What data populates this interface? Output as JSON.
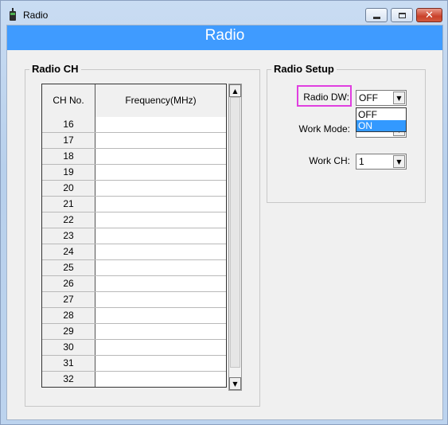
{
  "window": {
    "title": "Radio"
  },
  "banner": {
    "title": "Radio"
  },
  "radio_ch": {
    "group_title": "Radio CH",
    "headers": {
      "ch_no": "CH No.",
      "frequency": "Frequency(MHz)"
    },
    "rows": [
      {
        "ch": "16",
        "freq": ""
      },
      {
        "ch": "17",
        "freq": ""
      },
      {
        "ch": "18",
        "freq": ""
      },
      {
        "ch": "19",
        "freq": ""
      },
      {
        "ch": "20",
        "freq": ""
      },
      {
        "ch": "21",
        "freq": ""
      },
      {
        "ch": "22",
        "freq": ""
      },
      {
        "ch": "23",
        "freq": ""
      },
      {
        "ch": "24",
        "freq": ""
      },
      {
        "ch": "25",
        "freq": ""
      },
      {
        "ch": "26",
        "freq": ""
      },
      {
        "ch": "27",
        "freq": ""
      },
      {
        "ch": "28",
        "freq": ""
      },
      {
        "ch": "29",
        "freq": ""
      },
      {
        "ch": "30",
        "freq": ""
      },
      {
        "ch": "31",
        "freq": ""
      },
      {
        "ch": "32",
        "freq": ""
      }
    ]
  },
  "radio_setup": {
    "group_title": "Radio Setup",
    "radio_dw": {
      "label": "Radio DW:",
      "value": "OFF",
      "options": [
        "OFF",
        "ON"
      ],
      "highlighted_option": "ON"
    },
    "work_mode": {
      "label": "Work Mode:"
    },
    "work_ch": {
      "label": "Work CH:",
      "value": "1"
    }
  },
  "colors": {
    "banner": "#3f9bff",
    "highlight_box": "#e03fe0",
    "selected_option": "#3399ff"
  }
}
